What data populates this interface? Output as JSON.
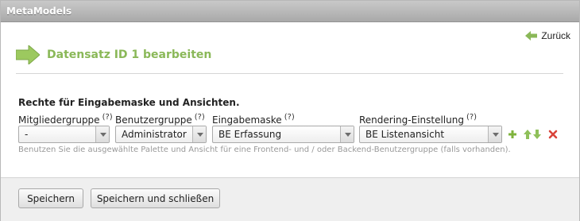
{
  "app": {
    "title": "MetaModels"
  },
  "nav": {
    "back_label": "Zurück"
  },
  "page": {
    "heading": "Datensatz ID 1 bearbeiten"
  },
  "section": {
    "title": "Rechte für Eingabemaske und Ansichten.",
    "hint": "Benutzen Sie die ausgewählte Palette und Ansicht für eine Frontend- und / oder Backend-Benutzergruppe (falls vorhanden)."
  },
  "columns": [
    {
      "label": "Mitgliedergruppe",
      "help": "(?)",
      "value": "-"
    },
    {
      "label": "Benutzergruppe",
      "help": "(?)",
      "value": "Administrator"
    },
    {
      "label": "Eingabemaske",
      "help": "(?)",
      "value": "BE Erfassung"
    },
    {
      "label": "Rendering-Einstellung",
      "help": "(?)",
      "value": "BE Listenansicht"
    }
  ],
  "row_actions": {
    "add": "plus-icon",
    "move_up": "arrow-up-icon",
    "move_down": "arrow-down-icon",
    "delete": "delete-icon"
  },
  "footer": {
    "save_label": "Speichern",
    "save_close_label": "Speichern und schließen"
  },
  "colors": {
    "accent_green": "#8ab858",
    "delete_red": "#d9443a",
    "hint_gray": "#999999"
  }
}
